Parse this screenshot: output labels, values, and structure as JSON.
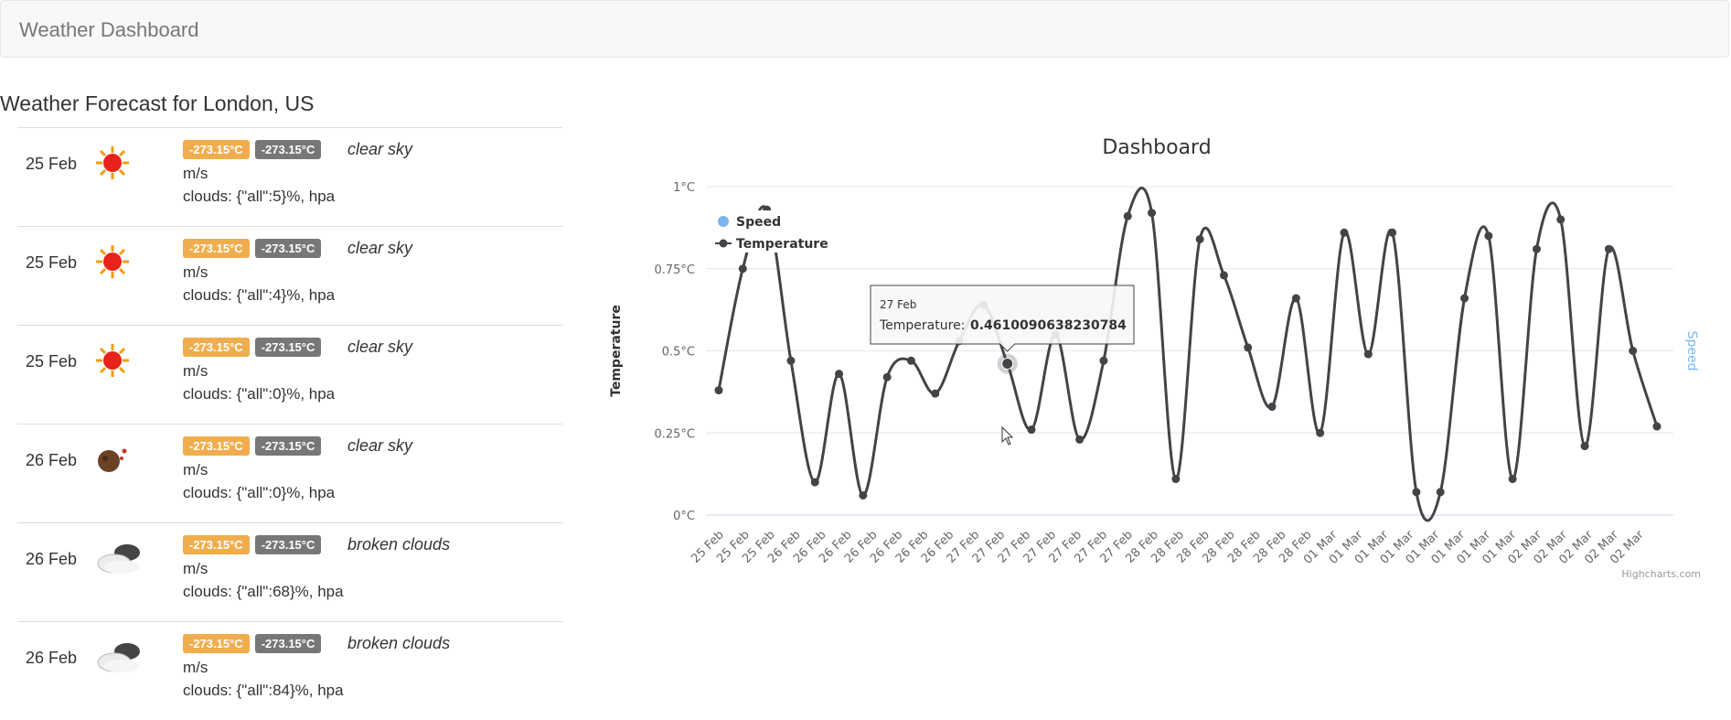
{
  "navbar": {
    "brand": "Weather Dashboard"
  },
  "forecast": {
    "title": "Weather Forecast for London, US",
    "items": [
      {
        "date": "25 Feb",
        "icon": "sun-icon",
        "temp_max": "-273.15°C",
        "temp_min": "-273.15°C",
        "description": "clear sky",
        "wind": "m/s",
        "clouds": "clouds: {\"all\":5}%, hpa"
      },
      {
        "date": "25 Feb",
        "icon": "sun-icon",
        "temp_max": "-273.15°C",
        "temp_min": "-273.15°C",
        "description": "clear sky",
        "wind": "m/s",
        "clouds": "clouds: {\"all\":4}%, hpa"
      },
      {
        "date": "25 Feb",
        "icon": "sun-icon",
        "temp_max": "-273.15°C",
        "temp_min": "-273.15°C",
        "description": "clear sky",
        "wind": "m/s",
        "clouds": "clouds: {\"all\":0}%, hpa"
      },
      {
        "date": "26 Feb",
        "icon": "moon-icon",
        "temp_max": "-273.15°C",
        "temp_min": "-273.15°C",
        "description": "clear sky",
        "wind": "m/s",
        "clouds": "clouds: {\"all\":0}%, hpa"
      },
      {
        "date": "26 Feb",
        "icon": "cloud-icon",
        "temp_max": "-273.15°C",
        "temp_min": "-273.15°C",
        "description": "broken clouds",
        "wind": "m/s",
        "clouds": "clouds: {\"all\":68}%, hpa"
      },
      {
        "date": "26 Feb",
        "icon": "cloud-icon",
        "temp_max": "-273.15°C",
        "temp_min": "-273.15°C",
        "description": "broken clouds",
        "wind": "m/s",
        "clouds": "clouds: {\"all\":84}%, hpa"
      }
    ]
  },
  "chart_data": {
    "type": "line",
    "title": "Dashboard",
    "ylabel": "Temperature",
    "ylabel_right": "Speed",
    "ylim": [
      0,
      1
    ],
    "yticks": [
      "0°C",
      "0.25°C",
      "0.5°C",
      "0.75°C",
      "1°C"
    ],
    "grid": true,
    "legend": "top-left",
    "credits": "Highcharts.com",
    "categories": [
      "25 Feb",
      "25 Feb",
      "25 Feb",
      "26 Feb",
      "26 Feb",
      "26 Feb",
      "26 Feb",
      "26 Feb",
      "26 Feb",
      "26 Feb",
      "27 Feb",
      "27 Feb",
      "27 Feb",
      "27 Feb",
      "27 Feb",
      "27 Feb",
      "27 Feb",
      "28 Feb",
      "28 Feb",
      "28 Feb",
      "28 Feb",
      "28 Feb",
      "28 Feb",
      "28 Feb",
      "01 Mar",
      "01 Mar",
      "01 Mar",
      "01 Mar",
      "01 Mar",
      "01 Mar",
      "01 Mar",
      "01 Mar",
      "02 Mar",
      "02 Mar",
      "02 Mar",
      "02 Mar",
      "02 Mar"
    ],
    "series": [
      {
        "name": "Speed",
        "color": "#7cb5ec",
        "values": []
      },
      {
        "name": "Temperature",
        "color": "#434348",
        "values": [
          0.38,
          0.75,
          0.93,
          0.47,
          0.1,
          0.43,
          0.06,
          0.42,
          0.47,
          0.37,
          0.53,
          0.64,
          0.461,
          0.26,
          0.55,
          0.23,
          0.47,
          0.91,
          0.92,
          0.11,
          0.84,
          0.73,
          0.51,
          0.33,
          0.66,
          0.25,
          0.86,
          0.49,
          0.86,
          0.07,
          0.07,
          0.66,
          0.85,
          0.11,
          0.81,
          0.9,
          0.21,
          0.81,
          0.5,
          0.27
        ]
      }
    ],
    "tooltip": {
      "date": "27 Feb",
      "label": "Temperature:",
      "value": "0.4610090638230784"
    }
  }
}
